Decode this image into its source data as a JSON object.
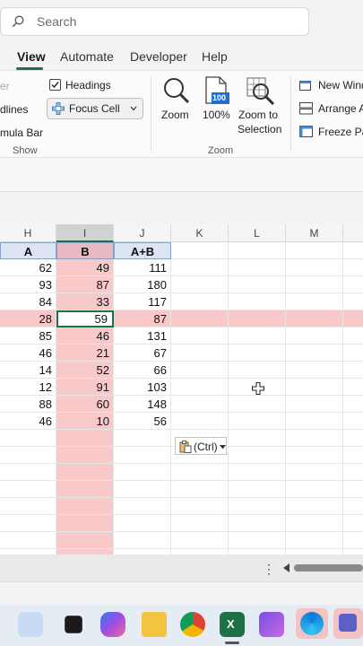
{
  "search": {
    "placeholder": "Search"
  },
  "tabs": [
    {
      "label": "View",
      "active": true
    },
    {
      "label": "Automate"
    },
    {
      "label": "Developer"
    },
    {
      "label": "Help"
    }
  ],
  "ribbon": {
    "show_group": {
      "ruler_partial": "er",
      "gridlines_partial": "dlines",
      "formula_bar_partial": "mula Bar",
      "headings_label": "Headings",
      "headings_checked": true,
      "focus_cell_label": "Focus Cell",
      "group_label": "Show"
    },
    "zoom_group": {
      "zoom_label": "Zoom",
      "zoom100_label": "100%",
      "zoom100_icon_text": "100",
      "zoom_to_selection_line1": "Zoom to",
      "zoom_to_selection_line2": "Selection",
      "group_label": "Zoom"
    },
    "window_group": {
      "new_window_partial": "New Wind",
      "arrange_partial": "Arrange A",
      "freeze_partial": "Freeze Pa"
    }
  },
  "columns": [
    "H",
    "I",
    "J",
    "K",
    "L",
    "M"
  ],
  "table": {
    "headers": [
      "A",
      "B",
      "A+B"
    ],
    "rows": [
      [
        "62",
        "49",
        "111"
      ],
      [
        "93",
        "87",
        "180"
      ],
      [
        "84",
        "33",
        "117"
      ],
      [
        "28",
        "59",
        "87"
      ],
      [
        "85",
        "46",
        "131"
      ],
      [
        "46",
        "21",
        "67"
      ],
      [
        "14",
        "52",
        "66"
      ],
      [
        "12",
        "91",
        "103"
      ],
      [
        "88",
        "60",
        "148"
      ],
      [
        "46",
        "10",
        "56"
      ]
    ]
  },
  "paste_options": {
    "label": "(Ctrl)"
  },
  "colors": {
    "accent_green": "#1e7145",
    "focus_pink": "#f9c9c9",
    "header_blue": "#dbe5f4"
  }
}
